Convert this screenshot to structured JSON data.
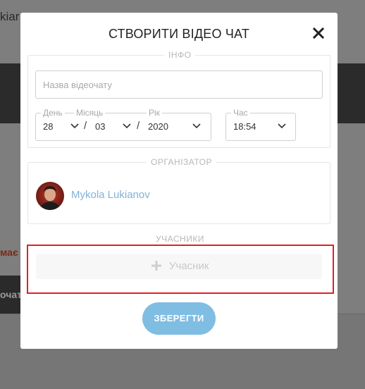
{
  "background": {
    "title_fragment": "kiar",
    "button_fragment": "очат",
    "warning_fragment": "має"
  },
  "modal": {
    "title": "СТВОРИТИ ВІДЕО ЧАТ",
    "close_icon": "close-icon",
    "info": {
      "legend": "ІНФО",
      "name_placeholder": "Назва відеочату",
      "name_value": "",
      "day_label": "День",
      "day_value": "28",
      "month_label": "Місяць",
      "month_value": "03",
      "year_label": "Рік",
      "year_value": "2020",
      "separator": "/",
      "time_label": "Час",
      "time_value": "18:54"
    },
    "organizer": {
      "legend": "ОРГАНІЗАТОР",
      "name": "Mykola Lukianov"
    },
    "participants": {
      "legend": "УЧАСНИКИ",
      "add_label": "Учасник",
      "add_icon": "plus-icon"
    },
    "save_label": "ЗБЕРЕГТИ"
  },
  "colors": {
    "accent": "#80bde2",
    "link": "#7fb3d8",
    "highlight": "#e31e24"
  }
}
